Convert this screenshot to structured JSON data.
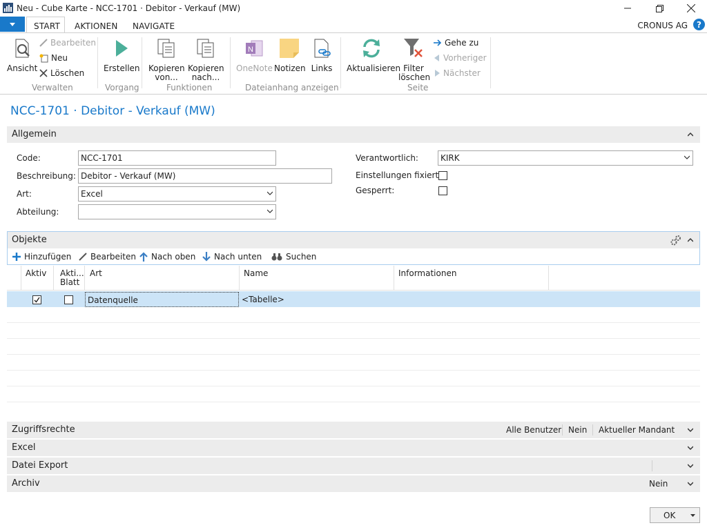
{
  "window": {
    "title": "Neu - Cube Karte - NCC-1701 · Debitor - Verkauf (MW)"
  },
  "ribbon_tabs": {
    "start": "START",
    "aktionen": "AKTIONEN",
    "navigate": "NAVIGATE"
  },
  "company": "CRONUS AG",
  "help": "?",
  "ribbon": {
    "verwalten": {
      "label": "Verwalten",
      "ansicht": "Ansicht",
      "bearbeiten": "Bearbeiten",
      "neu": "Neu",
      "loeschen": "Löschen"
    },
    "vorgang": {
      "label": "Vorgang",
      "erstellen": "Erstellen"
    },
    "funktionen": {
      "label": "Funktionen",
      "kopieren_von_1": "Kopieren",
      "kopieren_von_2": "von...",
      "kopieren_nach_1": "Kopieren",
      "kopieren_nach_2": "nach..."
    },
    "dateianhang": {
      "label": "Dateianhang anzeigen",
      "onenote": "OneNote",
      "notizen": "Notizen",
      "links": "Links"
    },
    "seite": {
      "label": "Seite",
      "aktualisieren": "Aktualisieren",
      "filter_1": "Filter",
      "filter_2": "löschen",
      "gehe_zu": "Gehe zu",
      "vorheriger": "Vorheriger",
      "naechster": "Nächster"
    }
  },
  "page_title": "NCC-1701 · Debitor - Verkauf (MW)",
  "allgemein": {
    "title": "Allgemein",
    "code_label": "Code:",
    "code_value": "NCC-1701",
    "beschreibung_label": "Beschreibung:",
    "beschreibung_value": "Debitor - Verkauf (MW)",
    "art_label": "Art:",
    "art_value": "Excel",
    "abteilung_label": "Abteilung:",
    "abteilung_value": "",
    "verantwortlich_label": "Verantwortlich:",
    "verantwortlich_value": "KIRK",
    "einstellungen_label": "Einstellungen fixiert:",
    "gesperrt_label": "Gesperrt:"
  },
  "objekte": {
    "title": "Objekte",
    "toolbar": {
      "hinzufuegen": "Hinzufügen",
      "bearbeiten": "Bearbeiten",
      "nach_oben": "Nach oben",
      "nach_unten": "Nach unten",
      "suchen": "Suchen"
    },
    "columns": {
      "aktiv": "Aktiv",
      "aktiv_blatt_1": "Akti...",
      "aktiv_blatt_2": "Blatt",
      "art": "Art",
      "name": "Name",
      "informationen": "Informationen"
    },
    "rows": [
      {
        "aktiv": true,
        "aktiv_blatt": false,
        "art": "Datenquelle",
        "name": "<Tabelle>",
        "informationen": ""
      }
    ]
  },
  "zugriffsrechte": {
    "title": "Zugriffsrechte",
    "v1": "Alle Benutzer",
    "v2": "Nein",
    "v3": "Aktueller Mandant"
  },
  "excel": {
    "title": "Excel"
  },
  "datei_export": {
    "title": "Datei Export"
  },
  "archiv": {
    "title": "Archiv",
    "v1": "Nein"
  },
  "ok_button": "OK",
  "colors": {
    "accent": "#1979ca",
    "selected_row": "#cce4f7",
    "fasttab": "#ececec"
  }
}
